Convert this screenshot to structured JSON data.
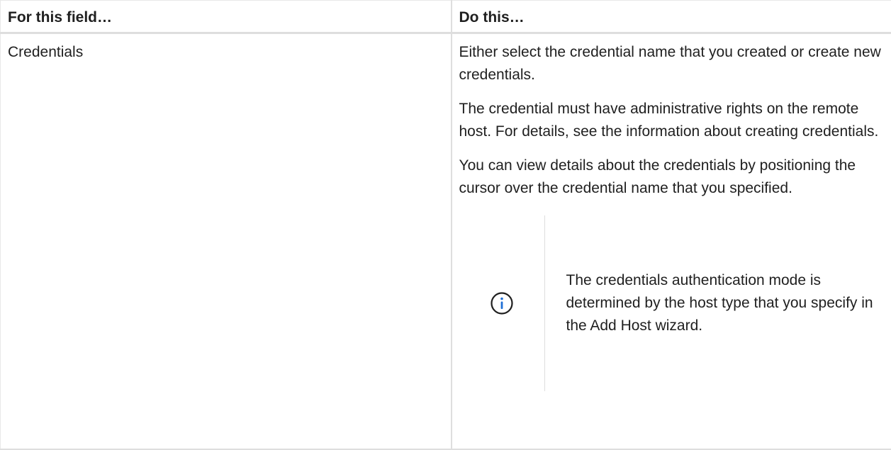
{
  "table": {
    "headers": [
      "For this field…",
      "Do this…"
    ],
    "row": {
      "field": "Credentials",
      "paragraphs": [
        "Either select the credential name that you created or create new credentials.",
        "The credential must have administrative rights on the remote host. For details, see the information about creating credentials.",
        "You can view details about the credentials by positioning the cursor over the credential name that you specified."
      ],
      "note": {
        "icon": "info-icon",
        "text": "The credentials authentication mode is determined by the host type that you specify in the Add Host wizard."
      }
    }
  },
  "colors": {
    "border": "#dedede",
    "text": "#1f1f1f",
    "icon": "#1f6fd6"
  }
}
